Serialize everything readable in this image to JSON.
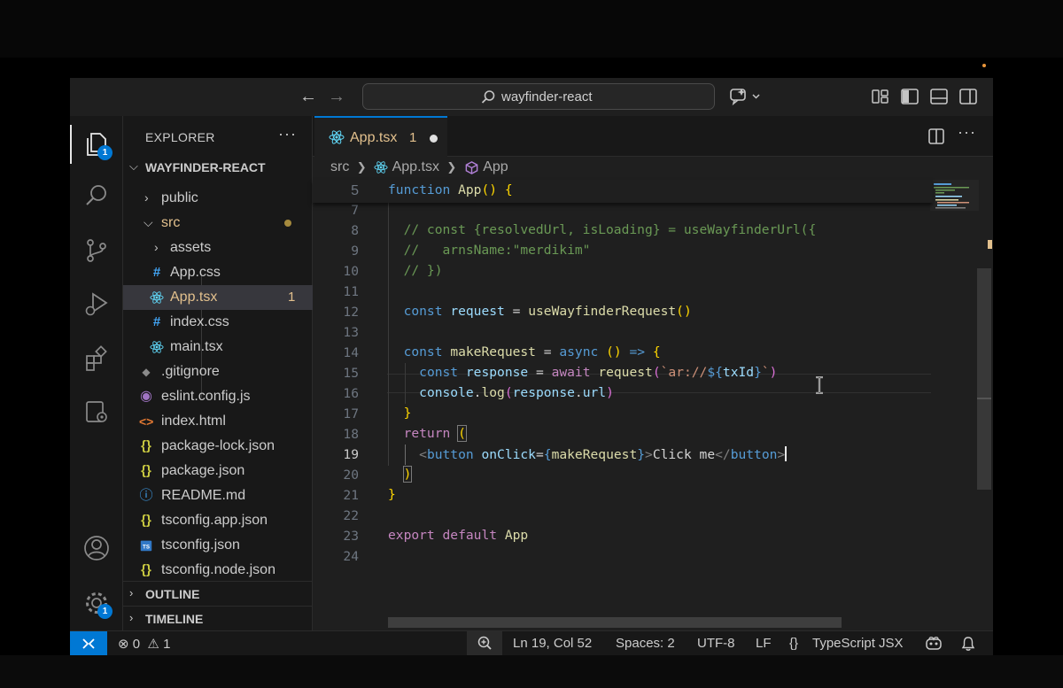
{
  "titlebar": {
    "command_center": "wayfinder-react"
  },
  "activity": {
    "explorer_badge": "1",
    "settings_badge": "1"
  },
  "explorer": {
    "title": "EXPLORER",
    "more": "···",
    "folder": "WAYFINDER-REACT",
    "items": [
      {
        "label": "public",
        "type": "folder-collapsed"
      },
      {
        "label": "src",
        "type": "folder-open"
      },
      {
        "label": "assets",
        "type": "folder-collapsed"
      },
      {
        "label": "App.css",
        "type": "css"
      },
      {
        "label": "App.tsx",
        "type": "react",
        "errors": "1"
      },
      {
        "label": "index.css",
        "type": "css"
      },
      {
        "label": "main.tsx",
        "type": "react"
      },
      {
        "label": ".gitignore",
        "type": "git"
      },
      {
        "label": "eslint.config.js",
        "type": "eslint"
      },
      {
        "label": "index.html",
        "type": "html"
      },
      {
        "label": "package-lock.json",
        "type": "json"
      },
      {
        "label": "package.json",
        "type": "json"
      },
      {
        "label": "README.md",
        "type": "info"
      },
      {
        "label": "tsconfig.app.json",
        "type": "json"
      },
      {
        "label": "tsconfig.json",
        "type": "ts"
      },
      {
        "label": "tsconfig.node.json",
        "type": "json"
      }
    ],
    "outline": "OUTLINE",
    "timeline": "TIMELINE"
  },
  "tab": {
    "name": "App.tsx",
    "problems": "1"
  },
  "breadcrumb": {
    "folder": "src",
    "file": "App.tsx",
    "symbol": "App"
  },
  "code": {
    "lines": [
      {
        "n": "5",
        "t": "function App() {"
      },
      {
        "n": "7",
        "t": ""
      },
      {
        "n": "8",
        "t": "  // const {resolvedUrl, isLoading} = useWayfinderUrl({"
      },
      {
        "n": "9",
        "t": "  //   arnsName:\"merdikim\""
      },
      {
        "n": "10",
        "t": "  // })"
      },
      {
        "n": "11",
        "t": ""
      },
      {
        "n": "12",
        "t": "  const request = useWayfinderRequest()"
      },
      {
        "n": "13",
        "t": ""
      },
      {
        "n": "14",
        "t": "  const makeRequest = async () => {"
      },
      {
        "n": "15",
        "t": "    const response = await request(`ar://${txId}`)"
      },
      {
        "n": "16",
        "t": "    console.log(response.url)"
      },
      {
        "n": "17",
        "t": "  }"
      },
      {
        "n": "18",
        "t": "  return ("
      },
      {
        "n": "19",
        "t": "    <button onClick={makeRequest}>Click me</button>"
      },
      {
        "n": "20",
        "t": "  )"
      },
      {
        "n": "21",
        "t": "}"
      },
      {
        "n": "22",
        "t": ""
      },
      {
        "n": "23",
        "t": "export default App"
      },
      {
        "n": "24",
        "t": ""
      }
    ]
  },
  "status": {
    "errors": "0",
    "warnings": "1",
    "position": "Ln 19, Col 52",
    "spaces": "Spaces: 2",
    "encoding": "UTF-8",
    "eol": "LF",
    "language_braces": "{}",
    "language": "TypeScript JSX"
  },
  "colors": {
    "accent": "#0078d4",
    "modified": "#e2c08d",
    "keyword": "#569cd6",
    "function": "#dcdcaa",
    "variable": "#9cdcfe",
    "comment": "#6a9955",
    "string": "#ce9178"
  }
}
